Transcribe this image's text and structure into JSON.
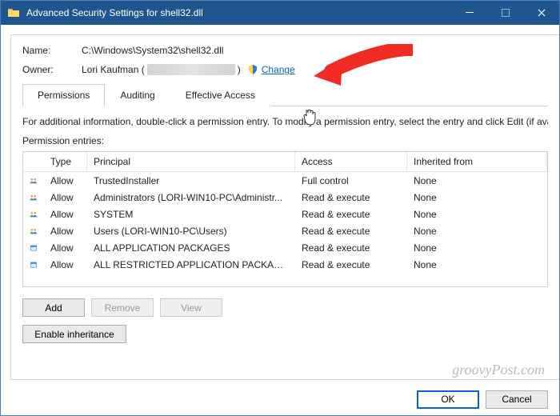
{
  "window": {
    "title": "Advanced Security Settings for shell32.dll"
  },
  "header": {
    "name_label": "Name:",
    "name_value": "C:\\Windows\\System32\\shell32.dll",
    "owner_label": "Owner:",
    "owner_name": "Lori Kaufman (",
    "owner_name_close": ")",
    "change_link": "Change"
  },
  "tabs": {
    "permissions": "Permissions",
    "auditing": "Auditing",
    "effective": "Effective Access"
  },
  "info_text": "For additional information, double-click a permission entry. To modify a permission entry, select the entry and click Edit (if availa",
  "entries_label": "Permission entries:",
  "columns": {
    "type": "Type",
    "principal": "Principal",
    "access": "Access",
    "inherited": "Inherited from"
  },
  "rows": [
    {
      "icon": "users",
      "type": "Allow",
      "principal": "TrustedInstaller",
      "access": "Full control",
      "inherited": "None"
    },
    {
      "icon": "users",
      "type": "Allow",
      "principal": "Administrators (LORI-WIN10-PC\\Administr...",
      "access": "Read & execute",
      "inherited": "None"
    },
    {
      "icon": "users",
      "type": "Allow",
      "principal": "SYSTEM",
      "access": "Read & execute",
      "inherited": "None"
    },
    {
      "icon": "users",
      "type": "Allow",
      "principal": "Users (LORI-WIN10-PC\\Users)",
      "access": "Read & execute",
      "inherited": "None"
    },
    {
      "icon": "pkg",
      "type": "Allow",
      "principal": "ALL APPLICATION PACKAGES",
      "access": "Read & execute",
      "inherited": "None"
    },
    {
      "icon": "pkg",
      "type": "Allow",
      "principal": "ALL RESTRICTED APPLICATION PACKAGES",
      "access": "Read & execute",
      "inherited": "None"
    }
  ],
  "buttons": {
    "add": "Add",
    "remove": "Remove",
    "view": "View",
    "enable_inh": "Enable inheritance",
    "ok": "OK",
    "cancel": "Cancel"
  },
  "watermark": "groovyPost.com",
  "colors": {
    "titlebar": "#205690",
    "link": "#0a63c2",
    "arrow": "#ef2b24"
  }
}
